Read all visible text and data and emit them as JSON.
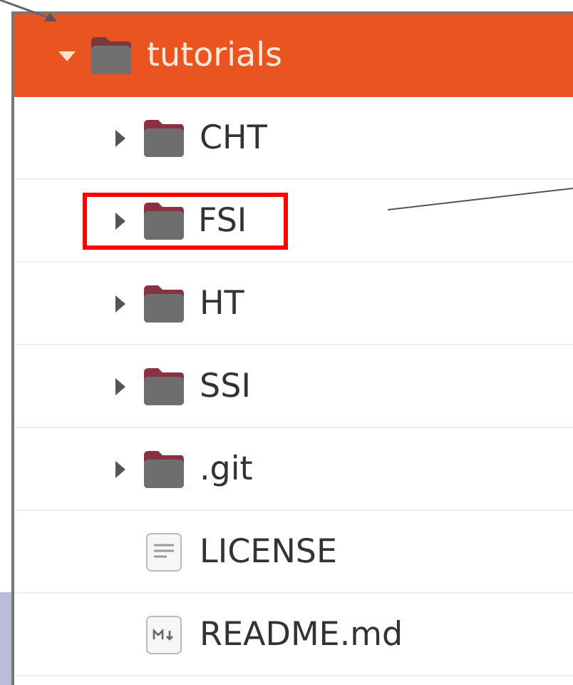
{
  "tree": {
    "name": "tutorials",
    "expanded": true,
    "selected": true,
    "children": [
      {
        "name": "CHT",
        "kind": "folder",
        "expanded": false,
        "marked": false
      },
      {
        "name": "FSI",
        "kind": "folder",
        "expanded": false,
        "marked": true
      },
      {
        "name": "HT",
        "kind": "folder",
        "expanded": false,
        "marked": false
      },
      {
        "name": "SSI",
        "kind": "folder",
        "expanded": false,
        "marked": false
      },
      {
        "name": ".git",
        "kind": "folder",
        "expanded": false,
        "marked": false
      },
      {
        "name": "LICENSE",
        "kind": "text",
        "marked": false
      },
      {
        "name": "README.md",
        "kind": "markdown",
        "marked": false
      }
    ]
  }
}
